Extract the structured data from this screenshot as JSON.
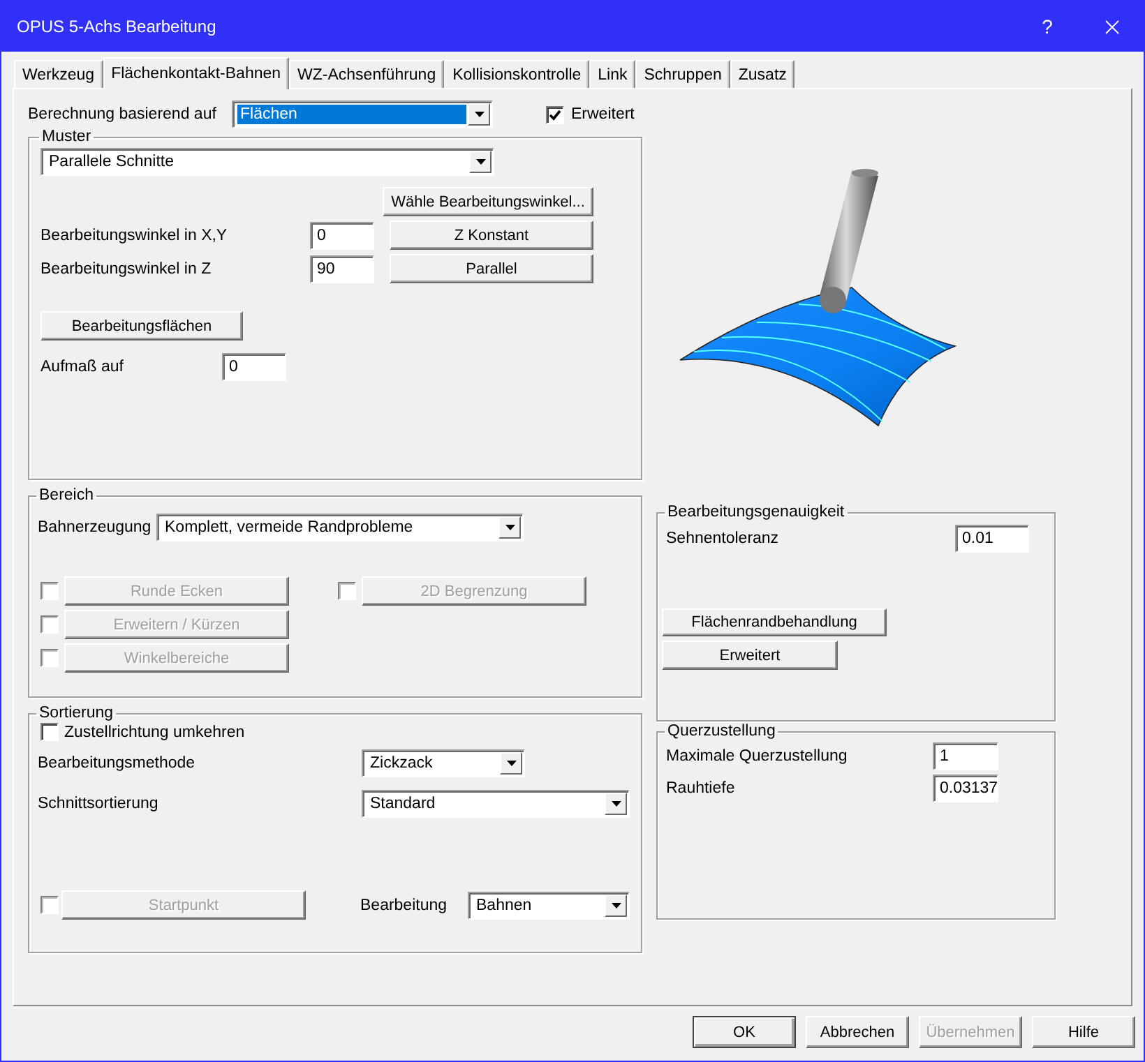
{
  "window": {
    "title": "OPUS 5-Achs Bearbeitung",
    "help": "?"
  },
  "tabs": [
    {
      "label": "Werkzeug",
      "selected": false
    },
    {
      "label": "Flächenkontakt-Bahnen",
      "selected": true
    },
    {
      "label": "WZ-Achsenführung",
      "selected": false
    },
    {
      "label": "Kollisionskontrolle",
      "selected": false
    },
    {
      "label": "Link",
      "selected": false
    },
    {
      "label": "Schruppen",
      "selected": false
    },
    {
      "label": "Zusatz",
      "selected": false
    }
  ],
  "calculation": {
    "label": "Berechnung basierend auf",
    "value": "Flächen",
    "focused": true
  },
  "extended": {
    "label": "Erweitert",
    "checked": true
  },
  "pattern": {
    "title": "Muster",
    "type": {
      "value": "Parallele Schnitte",
      "focused": false
    },
    "select_angle_button": "Wähle Bearbeitungswinkel...",
    "angles": [
      {
        "label": "Bearbeitungswinkel in X,Y",
        "value": "0",
        "button": "Z Konstant"
      },
      {
        "label": "Bearbeitungswinkel in Z",
        "value": "90",
        "button": "Parallel"
      }
    ],
    "surfaces_button": "Bearbeitungsflächen",
    "allowance": {
      "label": "Aufmaß auf",
      "value": "0"
    }
  },
  "range": {
    "title": "Bereich",
    "generation": {
      "label": "Bahnerzeugung",
      "value": "Komplett, vermeide Randprobleme",
      "focused": false
    },
    "option_columns": [
      {
        "options": [
          {
            "label": "Runde Ecken",
            "checked": false,
            "disabled": true
          },
          {
            "label": "Erweitern / Kürzen",
            "checked": false,
            "disabled": true
          },
          {
            "label": "Winkelbereiche",
            "checked": false,
            "disabled": true
          }
        ]
      },
      {
        "options": [
          {
            "label": "2D Begrenzung",
            "checked": false,
            "disabled": true
          }
        ]
      }
    ]
  },
  "sorting": {
    "title": "Sortierung",
    "reverse": {
      "label": "Zustellrichtung umkehren",
      "checked": false
    },
    "method": {
      "label": "Bearbeitungsmethode",
      "value": "Zickzack",
      "focused": false
    },
    "order": {
      "label": "Schnittsortierung",
      "value": "Standard",
      "focused": false
    },
    "start": {
      "label": "Startpunkt",
      "checked": false,
      "disabled": true
    },
    "machining": {
      "label": "Bearbeitung",
      "value": "Bahnen",
      "focused": false
    }
  },
  "accuracy": {
    "title": "Bearbeitungsgenauigkeit",
    "tolerance": {
      "label": "Sehnentoleranz",
      "value": "0.01"
    },
    "edge_button": "Flächenrandbehandlung",
    "extended_button": "Erweitert"
  },
  "stepover": {
    "title": "Querzustellung",
    "fields": [
      {
        "label": "Maximale Querzustellung",
        "value": "1"
      },
      {
        "label": "Rauhtiefe",
        "value": "0.03137"
      }
    ]
  },
  "buttons": [
    {
      "label": "OK",
      "default": true,
      "disabled": false
    },
    {
      "label": "Abbrechen",
      "default": false,
      "disabled": false
    },
    {
      "label": "Übernehmen",
      "default": false,
      "disabled": true
    },
    {
      "label": "Hilfe",
      "default": false,
      "disabled": false
    }
  ]
}
